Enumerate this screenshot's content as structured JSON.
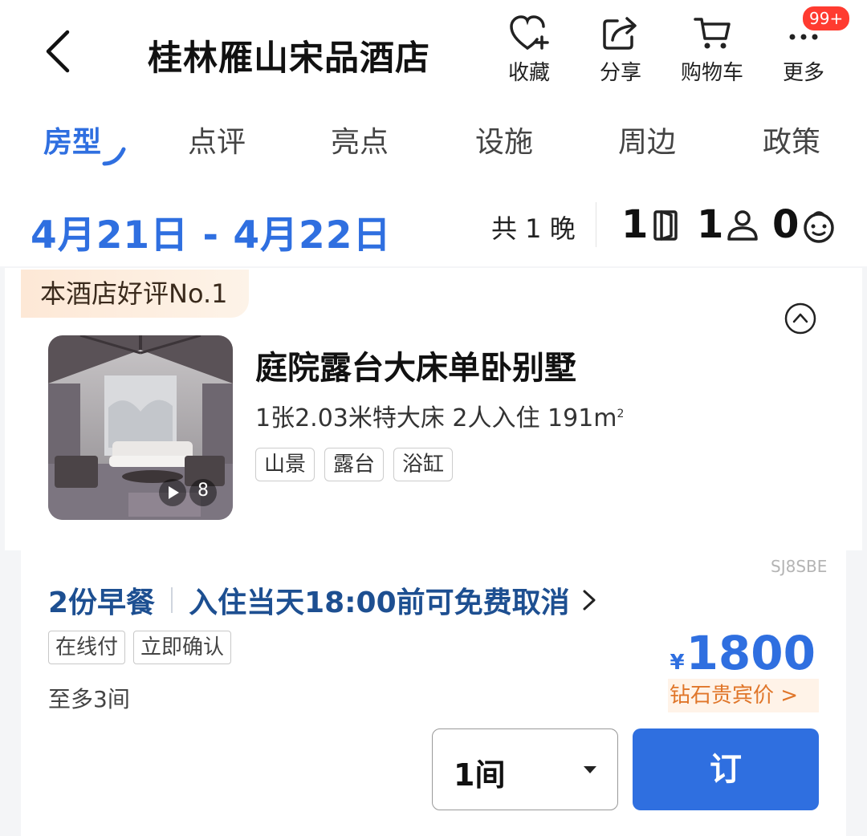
{
  "header": {
    "title": "桂林雁山宋品酒店",
    "back_icon": "chevron-left-icon",
    "actions": [
      {
        "label": "收藏",
        "icon": "heart-plus-icon"
      },
      {
        "label": "分享",
        "icon": "share-icon"
      },
      {
        "label": "购物车",
        "icon": "cart-icon"
      },
      {
        "label": "更多",
        "icon": "more-icon"
      }
    ],
    "more_badge": "99+"
  },
  "tabs": [
    {
      "label": "房型",
      "active": true
    },
    {
      "label": "点评"
    },
    {
      "label": "亮点"
    },
    {
      "label": "设施"
    },
    {
      "label": "周边"
    },
    {
      "label": "政策"
    }
  ],
  "stay": {
    "dates": "4月21日 - 4月22日",
    "nights": "共 1 晚",
    "rooms": "1",
    "adults": "1",
    "children": "0"
  },
  "room": {
    "ribbon": "本酒店好评No.1",
    "name": "庭院露台大床单卧别墅",
    "specs_main": "1张2.03米特大床  2人入住  191m",
    "specs_sup": "2",
    "tags": [
      "山景",
      "露台",
      "浴缸"
    ],
    "photo_count": "8"
  },
  "rate": {
    "code": "SJ8SBE",
    "breakfast": "2份早餐",
    "cancellation": "入住当天18:00前可免费取消",
    "tags": [
      "在线付",
      "立即确认"
    ],
    "max_rooms": "至多3间",
    "currency": "¥",
    "price": "1800",
    "vip_label": "钻石贵宾价 >",
    "quantity": "1间",
    "book_label": "订"
  },
  "colors": {
    "accent": "#2f6fe0",
    "rate_text": "#1d4f91",
    "vip": "#e0762a",
    "badge": "#ff3b30"
  }
}
